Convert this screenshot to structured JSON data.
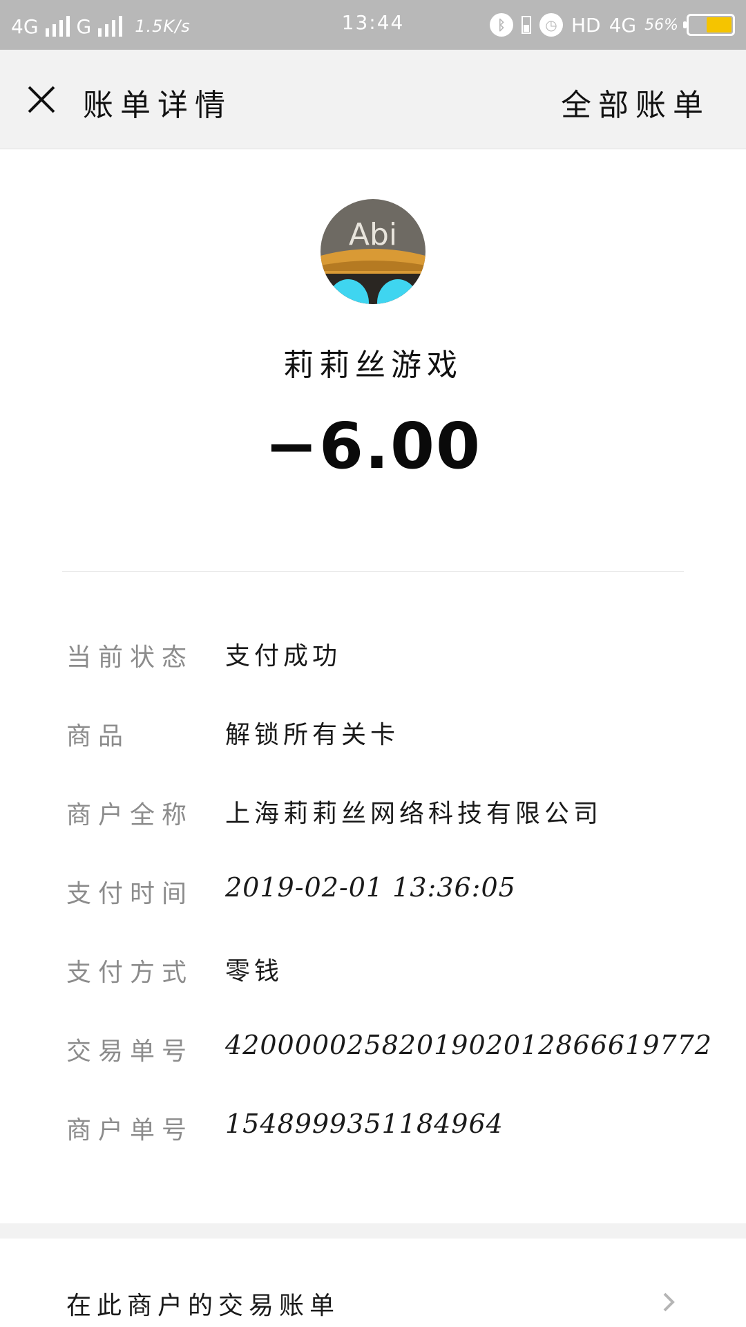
{
  "status_bar": {
    "network1": "4G",
    "network2": "G",
    "speed": "1.5K/s",
    "time": "13:44",
    "hd": "HD",
    "network3": "4G",
    "battery_text": "56%",
    "battery_level": 0.56,
    "battery_color": "#f5c400"
  },
  "header": {
    "title": "账单详情",
    "action_label": "全部账单",
    "close_icon": "close-icon"
  },
  "merchant": {
    "avatar_text": "Abi",
    "name": "莉莉丝游戏",
    "amount": "−6.00"
  },
  "details": [
    {
      "label": "当前状态",
      "value": "支付成功"
    },
    {
      "label": "商品",
      "value": "解锁所有关卡"
    },
    {
      "label": "商户全称",
      "value": "上海莉莉丝网络科技有限公司"
    },
    {
      "label": "支付时间",
      "value": "2019-02-01 13:36:05"
    },
    {
      "label": "支付方式",
      "value": "零钱"
    },
    {
      "label": "交易单号",
      "value": "4200000258201902012866619772"
    },
    {
      "label": "商户单号",
      "value": "1548999351184964"
    }
  ],
  "footer_link": {
    "label": "在此商户的交易账单",
    "icon": "chevron-right-icon"
  }
}
